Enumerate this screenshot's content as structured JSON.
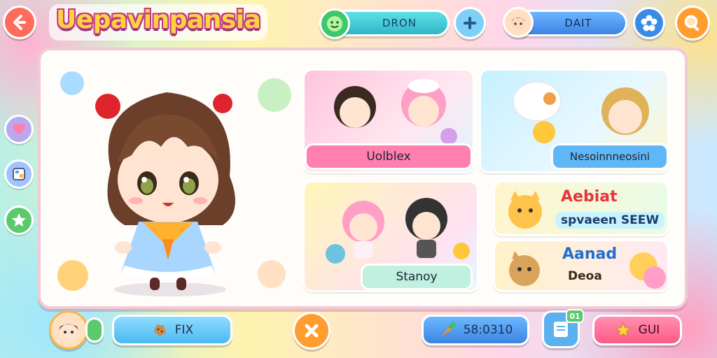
{
  "header": {
    "game_title": "Uepavinpansia",
    "currency_pill": "DRON",
    "player_pill": "DAIT"
  },
  "showcase": {
    "cards": [
      {
        "label": "Uolblex"
      },
      {
        "label": "Nesoinnneosini"
      },
      {
        "label": "Stanoy"
      },
      {
        "label": "Aebiat",
        "sublabel": "spvaeen SEEW"
      },
      {
        "label": "Aanad",
        "sublabel": "Deoa"
      }
    ]
  },
  "footer": {
    "fix_button_label": "FIX",
    "score_value": "58:0310",
    "gift_button_label": "GUI",
    "notification_count": "01"
  },
  "colors": {
    "accent_pink": "#ff6f9f",
    "accent_blue": "#3aa8e8",
    "accent_green": "#5cc96b",
    "accent_orange": "#ff9d2e"
  }
}
